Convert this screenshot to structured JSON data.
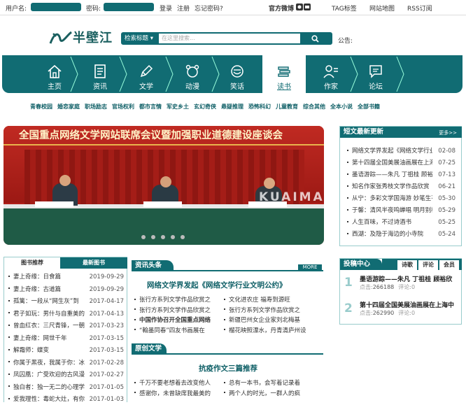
{
  "topbar": {
    "username_label": "用户名:",
    "password_label": "密码:",
    "login": "登录",
    "register": "注册",
    "forgot": "忘记密码?",
    "weibo": "官方微博",
    "tags": "TAG标签",
    "sitemap": "网站地图",
    "rss": "RSS订阅"
  },
  "header": {
    "logo": "半壁江",
    "search_cat": "检索标题",
    "search_placeholder": "在这里搜索...",
    "notice": "公告:"
  },
  "nav": [
    {
      "label": "主页",
      "icon": "home-icon"
    },
    {
      "label": "资讯",
      "icon": "news-icon"
    },
    {
      "label": "文学",
      "icon": "pen-icon"
    },
    {
      "label": "动漫",
      "icon": "bear-icon"
    },
    {
      "label": "笑话",
      "icon": "smile-icon"
    },
    {
      "label": "读书",
      "icon": "book-icon"
    },
    {
      "label": "作家",
      "icon": "writer-icon"
    },
    {
      "label": "论坛",
      "icon": "forum-icon"
    }
  ],
  "subnav": [
    "青春校园",
    "婚恋家庭",
    "职场励志",
    "官场权利",
    "都市言情",
    "军史乡土",
    "玄幻奇侠",
    "悬疑推理",
    "恐怖科幻",
    "儿童教育",
    "综合其他",
    "全本小说",
    "全部书籍"
  ],
  "banner": {
    "headline": "全国重点网络文学网站联席会议暨加强职业道德建设座谈会",
    "watermark": "KUAIMAO.COM"
  },
  "short_news": {
    "title": "短文最新更新",
    "more": "更多>>",
    "items": [
      {
        "t": "网络文学界发起《网络文学行业",
        "d": "02-08"
      },
      {
        "t": "第十四届全国美展油画展在上海",
        "d": "07-25"
      },
      {
        "t": "墨语游踪——朱凡 丁祖桂 顾裕",
        "d": "07-13"
      },
      {
        "t": "知名作家张秀枝文学作品欣赏",
        "d": "06-21"
      },
      {
        "t": "从宁：多彩文学国海游 妙笔生花",
        "d": "05-30"
      },
      {
        "t": "于馨：清风半夜鸣蝉唱 明月别枝",
        "d": "05-29"
      },
      {
        "t": "人生百味，不过诗酒书",
        "d": "05-25"
      },
      {
        "t": "西湖：及隐于海边的小寺院",
        "d": "05-24"
      }
    ]
  },
  "book_tabs": {
    "tab1": "图书推荐",
    "tab2": "最新图书"
  },
  "book_list": [
    {
      "t": "妻上奇缘：日食篇",
      "d": "2019-09-29"
    },
    {
      "t": "妻上奇缘：古道篇",
      "d": "2019-09-29"
    },
    {
      "t": "孤篱：一段从“网生灰”到",
      "d": "2017-04-17"
    },
    {
      "t": "君子如玩：男什与自重美的",
      "d": "2017-04-13"
    },
    {
      "t": "曾血红衣：三尺青锋，一朝",
      "d": "2017-03-23"
    },
    {
      "t": "妻上奇缘：网世千年",
      "d": "2017-03-15"
    },
    {
      "t": "解霜师：蝶变",
      "d": "2017-03-15"
    },
    {
      "t": "你属于黑夜，我属于你：冰",
      "d": "2017-02-28"
    },
    {
      "t": "凤囚凰：广受欢迎的古风漫",
      "d": "2017-02-27"
    },
    {
      "t": "独白者：独一无二的心理学",
      "d": "2017-01-05"
    },
    {
      "t": "爱我理性：毒蛇大灶，有你",
      "d": "2017-01-03"
    }
  ],
  "news": {
    "title": "资讯头条",
    "more": "MORE",
    "headline": "网络文学界发起《网络文学行业文明公约》",
    "items": [
      [
        "张行方系列文学作品欣赏之",
        "文化进农庄 福寿到源旺"
      ],
      [
        "张行方系列文学作品欣赏之",
        "张行方系列文学作品欣赏之"
      ],
      [
        "中国作协召开全国重点网络",
        "新疆巴州女企业家刘北梅基"
      ],
      [
        "“翰墨同春”四友书画展在",
        "榴花映照漂水，丹青清庐州设"
      ]
    ]
  },
  "original": {
    "title": "原创文学",
    "headline": "抗疫作文三篇推荐",
    "items": [
      [
        "千万不要老想着去改变他人",
        "总有一本书，会写着记录着"
      ],
      [
        "感谢你，未曾缺席我最美的",
        "两个人的时光，一群人的疯"
      ]
    ]
  },
  "contrib": {
    "title": "投稿中心",
    "tabs": [
      "诗歌",
      "评论",
      "会员"
    ],
    "items": [
      {
        "rank": "1",
        "t": "墨语游踪——朱凡 丁祖桂 顾裕欣",
        "hits": "266188",
        "cmt": "0"
      },
      {
        "rank": "2",
        "t": "第十四届全国美展油画展在上海中",
        "hits": "262990",
        "cmt": "0"
      }
    ],
    "hits_label": "点击:",
    "cmt_label": "评论:"
  }
}
